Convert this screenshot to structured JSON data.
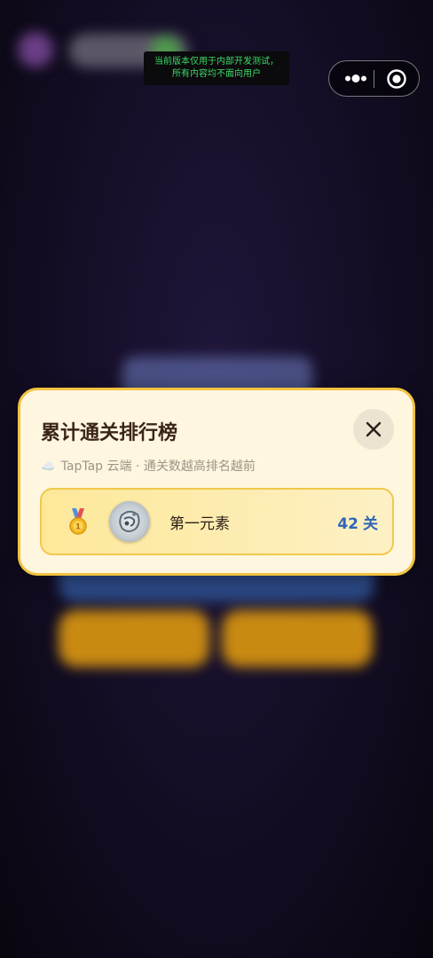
{
  "dev_notice": {
    "line1": "当前版本仅用于内部开发测试，",
    "line2": "所有内容均不面向用户"
  },
  "capsule": {
    "more_icon": "more-dots-icon",
    "close_icon": "target-circle-icon"
  },
  "leaderboard": {
    "title": "累计通关排行榜",
    "subtitle_icon": "☁️",
    "subtitle": "TapTap 云端 · 通关数越高排名越前",
    "close_icon": "close-icon",
    "entries": [
      {
        "medal": "gold-medal-icon",
        "name": "第一元素",
        "score": "42",
        "unit": "关"
      }
    ]
  },
  "colors": {
    "modal_bg": "#fff6e0",
    "modal_border": "#f2c240",
    "score_text": "#2f65b7",
    "dev_notice_text": "#3ddc6a"
  }
}
